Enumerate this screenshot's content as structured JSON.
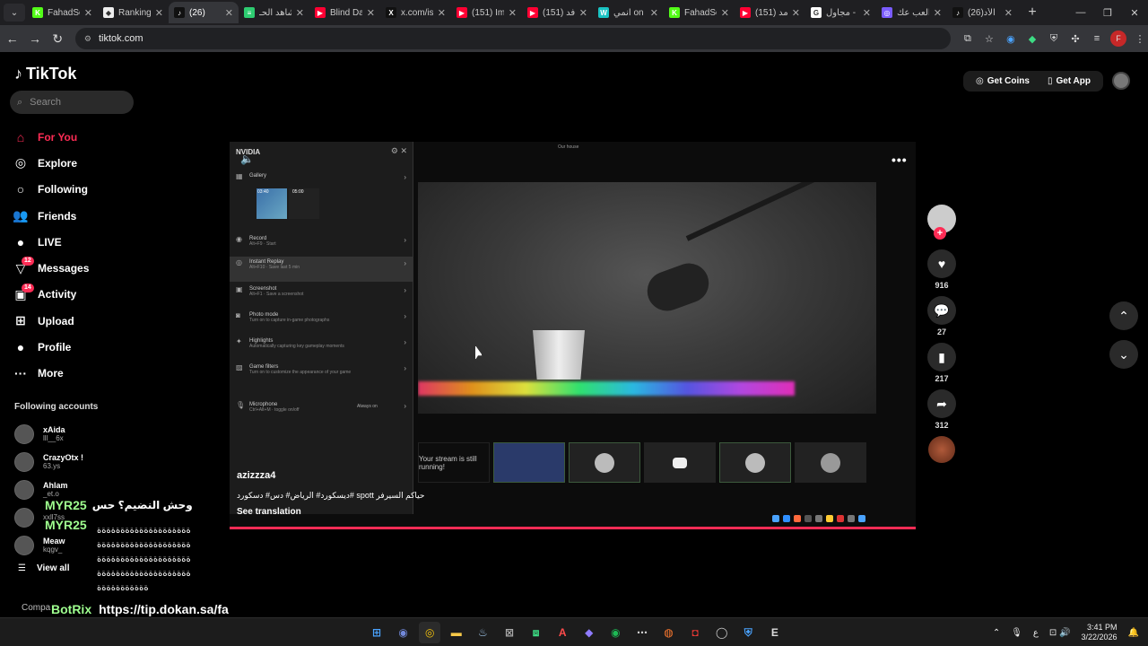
{
  "browser": {
    "tabs": [
      {
        "title": "FahadSc",
        "fav_color": "#53fc18",
        "fav_text": "K",
        "active": false
      },
      {
        "title": "Ranking",
        "fav_color": "#eeeeee",
        "fav_text": "◆",
        "active": false
      },
      {
        "title": "(26)",
        "fav_color": "#111111",
        "fav_text": "♪",
        "active": true
      },
      {
        "title": "شاهد الحـ",
        "fav_color": "#2ecc71",
        "fav_text": "≡",
        "active": false
      },
      {
        "title": "Blind Da",
        "fav_color": "#ff0033",
        "fav_text": "▶",
        "active": false
      },
      {
        "title": "x.com/is",
        "fav_color": "#111111",
        "fav_text": "X",
        "active": false
      },
      {
        "title": "(151) Im",
        "fav_color": "#ff0033",
        "fav_text": "▶",
        "active": false
      },
      {
        "title": "(151) فد",
        "fav_color": "#ff0033",
        "fav_text": "▶",
        "active": false
      },
      {
        "title": "انمي on",
        "fav_color": "#19c3c3",
        "fav_text": "W",
        "active": false
      },
      {
        "title": "FahadSc",
        "fav_color": "#53fc18",
        "fav_text": "K",
        "active": false
      },
      {
        "title": "(151) مد",
        "fav_color": "#ff0033",
        "fav_text": "▶",
        "active": false
      },
      {
        "title": "مجاول -",
        "fav_color": "#ffffff",
        "fav_text": "G",
        "active": false
      },
      {
        "title": "العب عك",
        "fav_color": "#7a5cff",
        "fav_text": "◎",
        "active": false
      },
      {
        "title": "(26)الأد",
        "fav_color": "#111111",
        "fav_text": "♪",
        "active": false
      }
    ],
    "url": "tiktok.com",
    "new_tab": "+"
  },
  "tiktok": {
    "logo": "TikTok",
    "search_placeholder": "Search",
    "nav": [
      {
        "label": "For You",
        "icon": "home-icon",
        "glyph": "⌂",
        "active": true,
        "badge": ""
      },
      {
        "label": "Explore",
        "icon": "compass-icon",
        "glyph": "◎",
        "active": false,
        "badge": ""
      },
      {
        "label": "Following",
        "icon": "following-icon",
        "glyph": "○",
        "active": false,
        "badge": ""
      },
      {
        "label": "Friends",
        "icon": "friends-icon",
        "glyph": "👥",
        "active": false,
        "badge": ""
      },
      {
        "label": "LIVE",
        "icon": "live-icon",
        "glyph": "●",
        "active": false,
        "badge": ""
      },
      {
        "label": "Messages",
        "icon": "messages-icon",
        "glyph": "▽",
        "active": false,
        "badge": "12"
      },
      {
        "label": "Activity",
        "icon": "activity-icon",
        "glyph": "▣",
        "active": false,
        "badge": "14"
      },
      {
        "label": "Upload",
        "icon": "upload-icon",
        "glyph": "⊞",
        "active": false,
        "badge": ""
      },
      {
        "label": "Profile",
        "icon": "profile-icon",
        "glyph": "●",
        "active": false,
        "badge": ""
      },
      {
        "label": "More",
        "icon": "more-icon",
        "glyph": "···",
        "active": false,
        "badge": ""
      }
    ],
    "following_title": "Following accounts",
    "accounts": [
      {
        "name": "xAida",
        "handle": "lll__6x"
      },
      {
        "name": "CrazyOtx !",
        "handle": "63.ys"
      },
      {
        "name": "Ahlam",
        "handle": "_et.o"
      },
      {
        "name": "",
        "handle": "xxll7ss"
      },
      {
        "name": "Meaw",
        "handle": "kqgv_"
      }
    ],
    "view_all": "View all",
    "company": "Compa",
    "get_coins": "Get Coins",
    "get_app": "Get App",
    "video": {
      "username": "azizzza4",
      "caption": "ديسكورد# الرياض# دس# دسكورد# spott حياكم السيرفر",
      "see_translation": "See translation",
      "nvidia_title": "NVIDIA",
      "stream_label": "Our house",
      "menu": [
        {
          "label": "Gallery",
          "sub": ""
        },
        {
          "label": "Record",
          "sub": "Alt+F9 · Start"
        },
        {
          "label": "Instant Replay",
          "sub": "Alt+F10 · Save last 5 min"
        },
        {
          "label": "Screenshot",
          "sub": "Alt+F1 · Save a screenshot"
        },
        {
          "label": "Photo mode",
          "sub": "Turn on to capture in-game photographs"
        },
        {
          "label": "Highlights",
          "sub": "Automatically capturing key gameplay moments"
        },
        {
          "label": "Game filters",
          "sub": "Turn on to customize the appearance of your game"
        },
        {
          "label": "Microphone",
          "sub": "Ctrl+Alt+M · toggle on/off"
        }
      ],
      "gallery_times": [
        "03:40",
        "05:00"
      ],
      "mic_state": "Always on",
      "stream_notice": "Your stream is still running!"
    },
    "actions": [
      {
        "icon": "heart-icon",
        "glyph": "♥",
        "count": "916"
      },
      {
        "icon": "comment-icon",
        "glyph": "💬",
        "count": "27"
      },
      {
        "icon": "bookmark-icon",
        "glyph": "▮",
        "count": "217"
      },
      {
        "icon": "share-icon",
        "glyph": "➦",
        "count": "312"
      }
    ]
  },
  "chat_overlay": {
    "line1_user": "MYR25",
    "line1_msg": "وحش النضيم؟ حس",
    "line2_user": "MYR25",
    "garbled": "ةةةةةةةةةةةةةةةةةةةة ةةةةةةةةةةةةةةةةةةةة ةةةةةةةةةةةةةةةةةةةة ةةةةةةةةةةةةةةةةةةةة ةةةةةةةةةةة",
    "bot_user": "BotRix",
    "bot_msg": "https://tip.dokan.sa/fa hadsc"
  },
  "taskbar": {
    "time": "3:41 PM",
    "date": "3/22/2026",
    "lang": "ع"
  }
}
